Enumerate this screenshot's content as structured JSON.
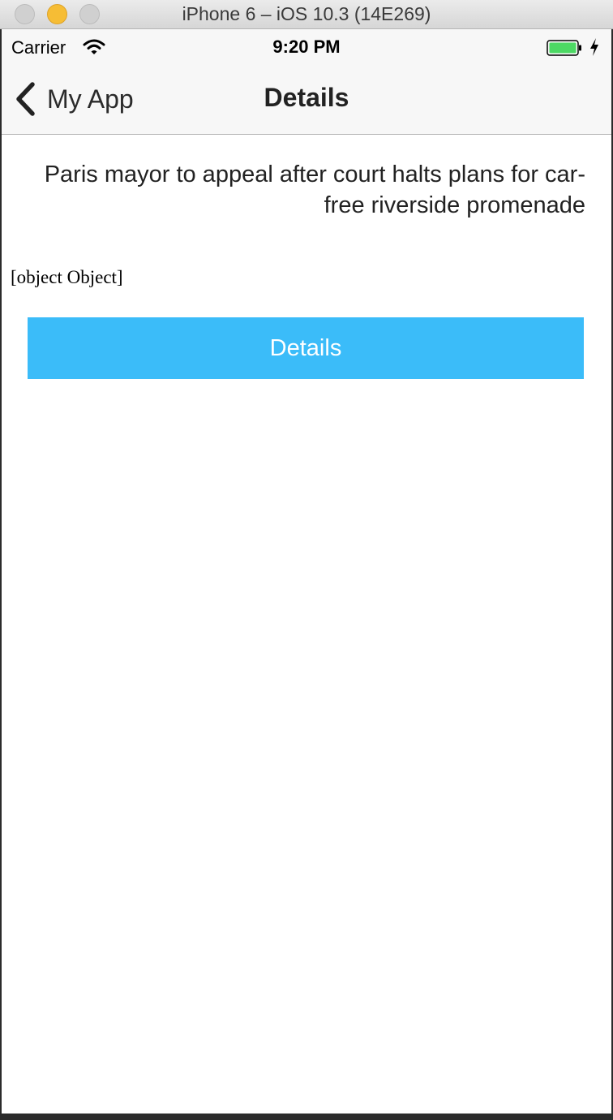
{
  "window": {
    "title": "iPhone 6 – iOS 10.3 (14E269)"
  },
  "status_bar": {
    "carrier": "Carrier",
    "time": "9:20 PM",
    "wifi_icon": "wifi-icon",
    "battery_icon": "battery-icon",
    "battery_color": "#4cd964"
  },
  "nav": {
    "back_label": "My App",
    "back_icon": "chevron-left-icon",
    "title": "Details"
  },
  "content": {
    "headline": "Paris mayor to appeal after court halts plans for car-free riverside promenade",
    "object_text": "[object Object]",
    "button_label": "Details",
    "button_color": "#3bbcf9"
  }
}
